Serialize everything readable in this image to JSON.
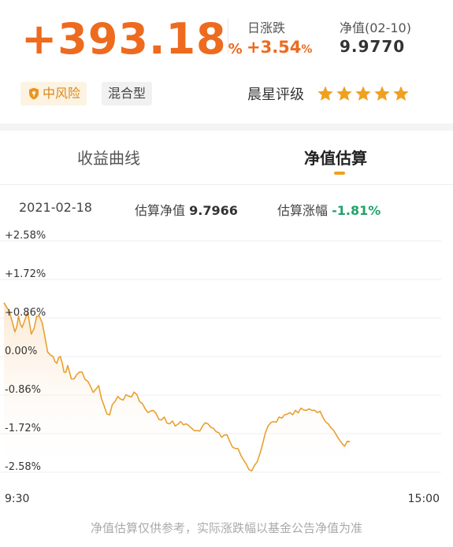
{
  "summary": {
    "total_return_value": "+393.18",
    "total_return_unit": "%",
    "daily_change_label": "日涨跌",
    "daily_change_value": "+3.54",
    "daily_change_unit": "%",
    "nav_label": "净值(02-10)",
    "nav_value": "9.9770"
  },
  "tags": {
    "risk": "中风险",
    "fund_type": "混合型"
  },
  "rating": {
    "label": "晨星评级",
    "stars": 5,
    "star_color": "#f0a020"
  },
  "tabs": [
    {
      "label": "收益曲线",
      "active": false
    },
    {
      "label": "净值估算",
      "active": true
    }
  ],
  "estimate": {
    "date": "2021-02-18",
    "nav_label": "估算净值",
    "nav_value": "9.7966",
    "change_label": "估算涨幅",
    "change_value": "-1.81%"
  },
  "colors": {
    "accent": "#ee6a1e",
    "line": "#e8a030",
    "negative": "#21a36a"
  },
  "chart_data": {
    "type": "line",
    "title": "",
    "xlabel": "",
    "ylabel": "",
    "y_tick_labels": [
      "+2.58%",
      "+1.72%",
      "+0.86%",
      "0.00%",
      "-0.86%",
      "-1.72%",
      "-2.58%"
    ],
    "y_ticks": [
      2.58,
      1.72,
      0.86,
      0.0,
      -0.86,
      -1.72,
      -2.58
    ],
    "ylim": [
      -2.58,
      2.58
    ],
    "x_tick_labels": [
      "9:30",
      "15:00"
    ],
    "xlim": [
      0,
      240
    ],
    "grid": true,
    "series": [
      {
        "x": [
          0,
          3,
          6,
          8,
          10,
          13,
          15,
          18,
          21,
          24,
          27,
          29,
          31,
          33,
          35,
          37,
          40,
          43,
          46,
          49,
          52,
          55,
          58,
          61,
          64,
          67,
          70,
          73,
          76,
          79,
          82,
          85,
          88,
          91,
          94,
          97,
          100,
          103,
          106,
          109,
          112,
          115,
          118,
          121,
          124,
          127,
          130,
          133,
          136,
          139,
          142,
          145,
          148,
          151,
          154,
          157,
          160,
          163,
          166,
          169,
          172,
          175,
          178,
          181,
          184,
          187,
          190
        ],
        "y": [
          1.2,
          1.0,
          0.55,
          0.9,
          0.65,
          1.0,
          0.5,
          0.9,
          0.75,
          0.1,
          0.0,
          -0.15,
          0.0,
          -0.35,
          -0.2,
          -0.5,
          -0.4,
          -0.35,
          -0.55,
          -0.8,
          -0.65,
          -1.1,
          -1.3,
          -1.0,
          -0.95,
          -0.85,
          -0.9,
          -0.85,
          -1.05,
          -1.25,
          -1.2,
          -1.4,
          -1.35,
          -1.5,
          -1.55,
          -1.45,
          -1.5,
          -1.6,
          -1.65,
          -1.55,
          -1.5,
          -1.6,
          -1.7,
          -1.75,
          -1.9,
          -2.05,
          -2.2,
          -2.4,
          -2.55,
          -2.35,
          -1.95,
          -1.55,
          -1.45,
          -1.35,
          -1.3,
          -1.25,
          -1.2,
          -1.15,
          -1.2,
          -1.2,
          -1.25,
          -1.35,
          -1.5,
          -1.65,
          -1.85,
          -2.0,
          -1.9
        ]
      }
    ]
  },
  "disclaimer": "净值估算仅供参考，实际涨跌幅以基金公告净值为准"
}
